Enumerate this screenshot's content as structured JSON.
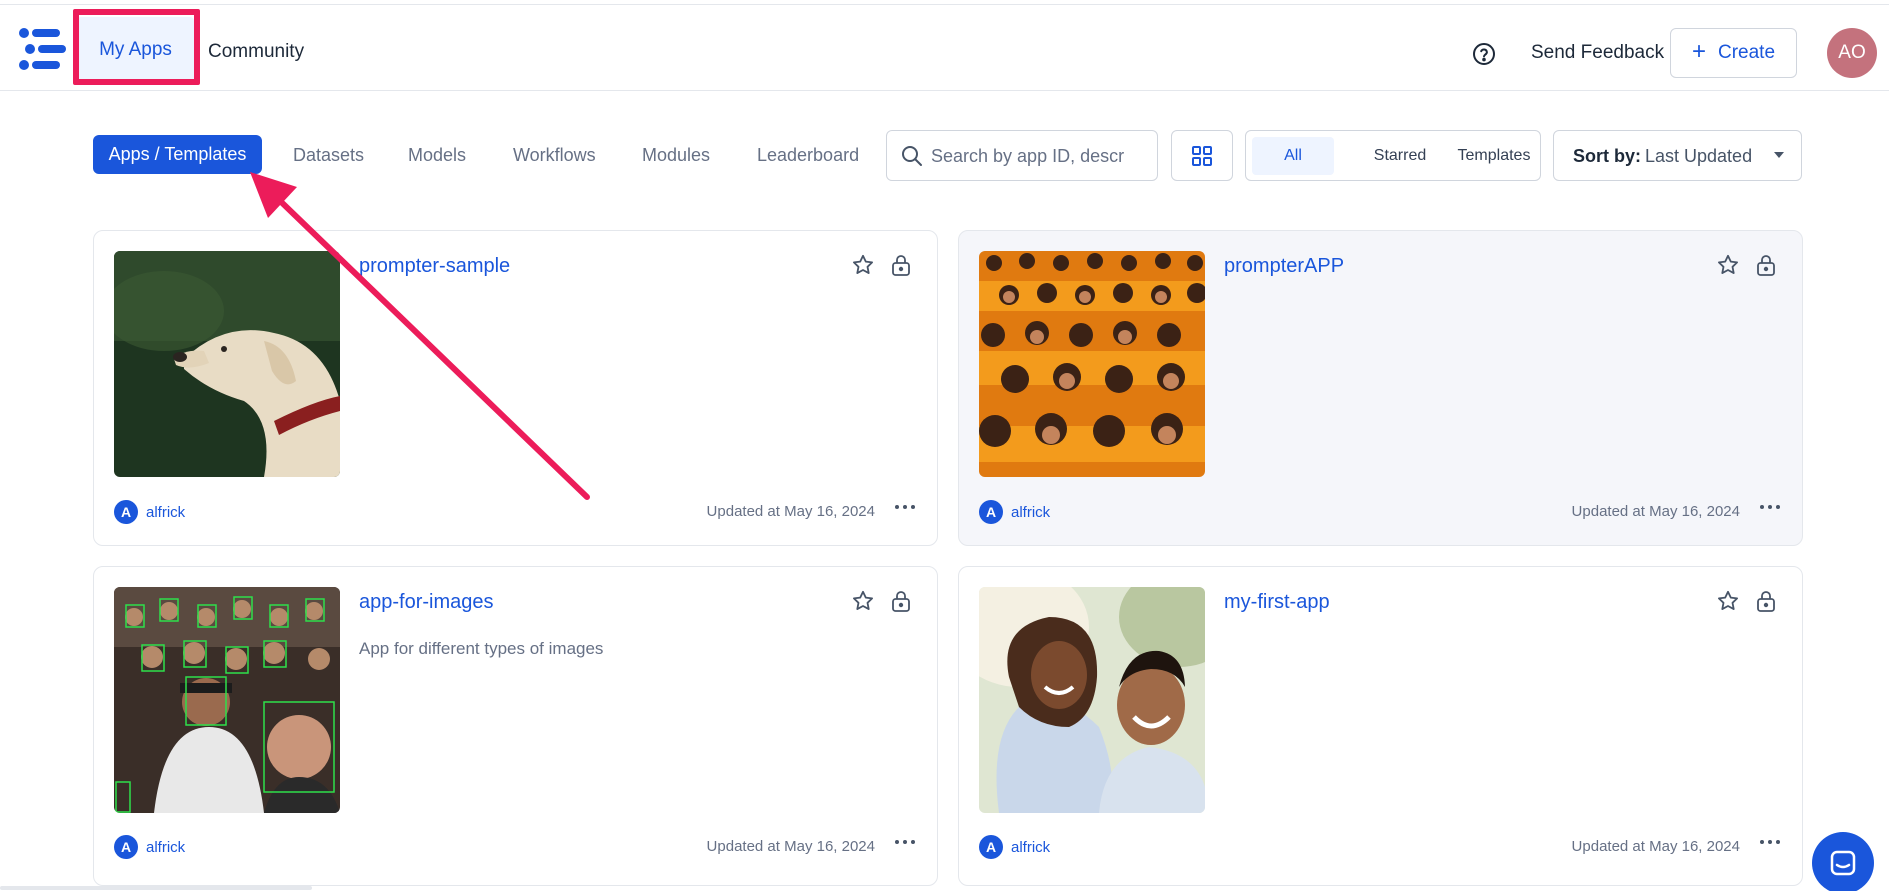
{
  "header": {
    "my_apps": "My Apps",
    "community": "Community",
    "send_feedback": "Send Feedback",
    "create_label": "Create",
    "avatar_initials": "AO",
    "help_icon": "question-circle-icon"
  },
  "toolbar": {
    "tabs": [
      "Apps / Templates",
      "Datasets",
      "Models",
      "Workflows",
      "Modules",
      "Leaderboard"
    ],
    "active_tab": "Apps / Templates",
    "search_placeholder": "Search by app ID, descr",
    "filters": [
      "All",
      "Starred",
      "Templates"
    ],
    "active_filter": "All",
    "sort_label": "Sort by:",
    "sort_value": "Last Updated"
  },
  "apps": [
    {
      "name": "prompter-sample",
      "description": "",
      "owner": "alfrick",
      "owner_initial": "A",
      "updated": "Updated at May 16, 2024",
      "thumbnail": "dog-portrait"
    },
    {
      "name": "prompterAPP",
      "description": "",
      "owner": "alfrick",
      "owner_initial": "A",
      "updated": "Updated at May 16, 2024",
      "thumbnail": "monks-crowd"
    },
    {
      "name": "app-for-images",
      "description": "App for different types of images",
      "owner": "alfrick",
      "owner_initial": "A",
      "updated": "Updated at May 16, 2024",
      "thumbnail": "concert-crowd-face-detection"
    },
    {
      "name": "my-first-app",
      "description": "",
      "owner": "alfrick",
      "owner_initial": "A",
      "updated": "Updated at May 16, 2024",
      "thumbnail": "smiling-couple"
    }
  ],
  "colors": {
    "accent": "#1a56db",
    "highlight": "#ec1c5a",
    "avatar": "#c4727d"
  }
}
